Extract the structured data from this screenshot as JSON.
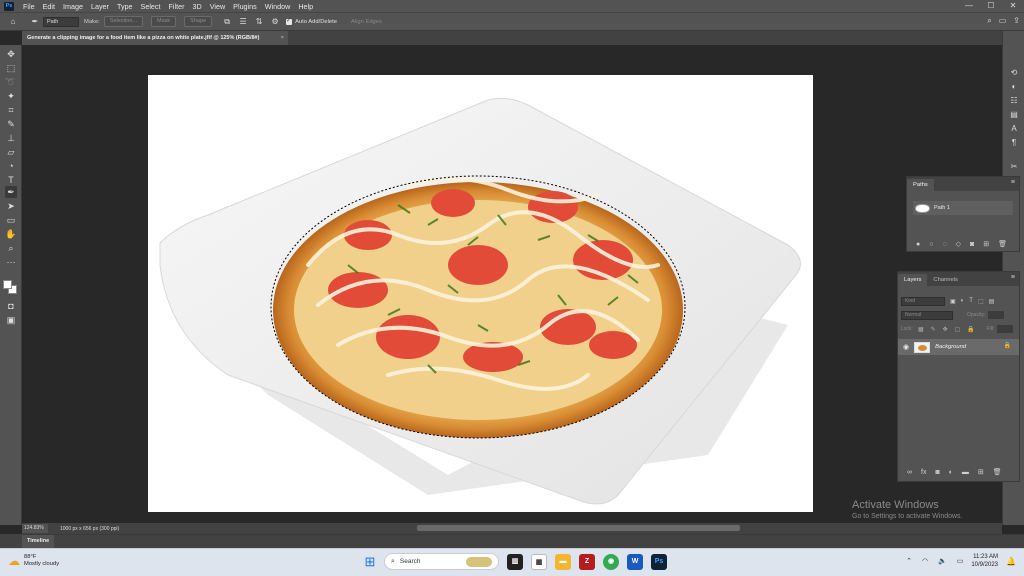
{
  "menubar": {
    "logo": "Ps",
    "items": [
      "File",
      "Edit",
      "Image",
      "Layer",
      "Type",
      "Select",
      "Filter",
      "3D",
      "View",
      "Plugins",
      "Window",
      "Help"
    ],
    "minimize": "—",
    "maximize": "☐",
    "close": "✕"
  },
  "options": {
    "pen_mode": "Path",
    "make_label": "Make:",
    "selection_btn": "Selection...",
    "mask_btn": "Mask",
    "shape_btn": "Shape",
    "auto_add_delete": "Auto Add/Delete",
    "align_edges": "Align Edges"
  },
  "document": {
    "tab_title": "Generate a clipping image for a food item like a pizza on white plate.jfif @ 125% (RGB/8#)",
    "close": "×"
  },
  "paths_panel": {
    "tab": "Paths",
    "path_name": "Path 1"
  },
  "layers_panel": {
    "tabs": [
      "Layers",
      "Channels"
    ],
    "kind_placeholder": "Kind",
    "blend_mode": "Normal",
    "opacity_label": "Opacity:",
    "lock_label": "Lock:",
    "fill_label": "Fill:",
    "layer_name": "Background"
  },
  "status": {
    "zoom": "124.83%",
    "doc_info": "1000 px x 656 px (300 ppi)"
  },
  "timeline": {
    "tab": "Timeline"
  },
  "activation": {
    "line1": "Activate Windows",
    "line2": "Go to Settings to activate Windows."
  },
  "taskbar": {
    "weather_temp": "88°F",
    "weather_desc": "Mostly cloudy",
    "search": "Search",
    "time": "11:23 AM",
    "date": "10/9/2023"
  },
  "colors": {
    "accent": "#1473e6",
    "marching_ants": "#000000"
  }
}
